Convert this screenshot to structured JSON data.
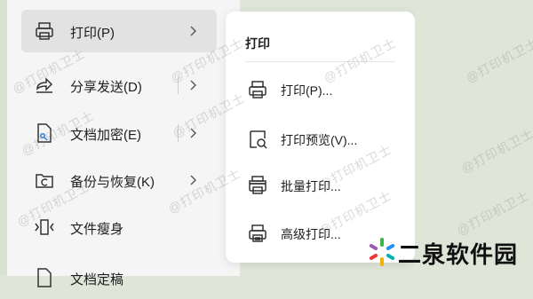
{
  "menu": {
    "items": [
      {
        "label": "打印(P)",
        "icon": "printer-icon",
        "selected": true,
        "has_submenu": true
      },
      {
        "label": "分享发送(D)",
        "icon": "share-icon",
        "selected": false,
        "has_submenu": true
      },
      {
        "label": "文档加密(E)",
        "icon": "document-lock-icon",
        "selected": false,
        "has_submenu": true
      },
      {
        "label": "备份与恢复(K)",
        "icon": "backup-icon",
        "selected": false,
        "has_submenu": true
      },
      {
        "label": "文件瘦身",
        "icon": "file-compress-icon",
        "selected": false,
        "has_submenu": false
      },
      {
        "label": "文档定稿",
        "icon": "document-finalize-icon",
        "selected": false,
        "has_submenu": false
      }
    ]
  },
  "submenu": {
    "title": "打印",
    "items": [
      {
        "label": "打印(P)...",
        "icon": "printer-icon"
      },
      {
        "label": "打印预览(V)...",
        "icon": "print-preview-icon"
      },
      {
        "label": "批量打印...",
        "icon": "batch-print-icon"
      },
      {
        "label": "高级打印...",
        "icon": "advanced-print-icon"
      }
    ]
  },
  "watermark": {
    "text": "@打印机卫士"
  },
  "logo": {
    "text": "二泉软件园"
  },
  "colors": {
    "background": "#dfe6d8",
    "menu_bg": "#f5f5f5",
    "selected_bg": "#e2e2e2",
    "submenu_bg": "#ffffff"
  }
}
